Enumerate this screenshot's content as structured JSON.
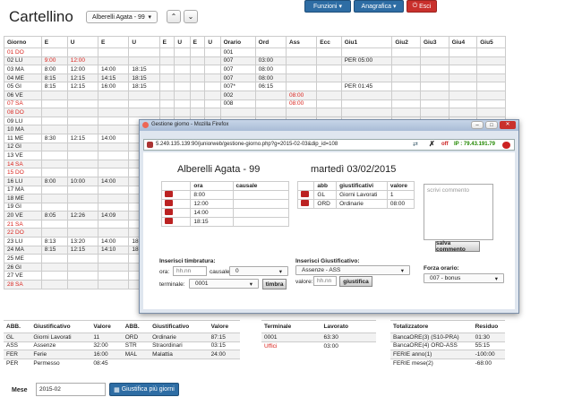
{
  "title": "Cartellino",
  "employee_select": "Alberelli Agata - 99",
  "nav": {
    "funzioni": "Funzioni",
    "anagrafica": "Anagrafica",
    "esci": "Esci"
  },
  "grid": {
    "headers": [
      "Giorno",
      "E",
      "U",
      "E",
      "U",
      "E",
      "U",
      "E",
      "U",
      "Orario",
      "Ord",
      "Ass",
      "Ecc",
      "Giu1",
      "Giu2",
      "Giu3",
      "Giu4",
      "Giu5"
    ],
    "rows": [
      [
        "01 DO",
        "",
        "",
        "",
        "",
        "",
        "",
        "",
        "",
        "001",
        "",
        "",
        "",
        "",
        "",
        "",
        "",
        ""
      ],
      [
        "02 LU",
        "9:00",
        "12:00",
        "",
        "",
        "",
        "",
        "",
        "",
        "007",
        "03:00",
        "",
        "",
        "PER 05:00",
        "",
        "",
        "",
        ""
      ],
      [
        "03 MA",
        "8:00",
        "12:00",
        "14:00",
        "18:15",
        "",
        "",
        "",
        "",
        "007",
        "08:00",
        "",
        "",
        "",
        "",
        "",
        "",
        ""
      ],
      [
        "04 ME",
        "8:15",
        "12:15",
        "14:15",
        "18:15",
        "",
        "",
        "",
        "",
        "007",
        "08:00",
        "",
        "",
        "",
        "",
        "",
        "",
        ""
      ],
      [
        "05 GI",
        "8:15",
        "12:15",
        "16:00",
        "18:15",
        "",
        "",
        "",
        "",
        "007*",
        "06:15",
        "",
        "",
        "PER 01:45",
        "",
        "",
        "",
        ""
      ],
      [
        "06 VE",
        "",
        "",
        "",
        "",
        "",
        "",
        "",
        "",
        "002",
        "",
        "08:00",
        "",
        "",
        "",
        "",
        "",
        ""
      ],
      [
        "07 SA",
        "",
        "",
        "",
        "",
        "",
        "",
        "",
        "",
        "008",
        "",
        "08:00",
        "",
        "",
        "",
        "",
        "",
        ""
      ],
      [
        "08 DO",
        "",
        "",
        "",
        "",
        "",
        "",
        "",
        "",
        "",
        "",
        "",
        "",
        "",
        "",
        "",
        "",
        ""
      ],
      [
        "09 LU",
        "",
        "",
        "",
        "",
        "",
        "",
        "",
        "",
        "",
        "",
        "",
        "",
        "",
        "",
        "",
        "",
        ""
      ],
      [
        "10 MA",
        "",
        "",
        "",
        "",
        "",
        "",
        "",
        "",
        "",
        "",
        "",
        "",
        "",
        "",
        "",
        "",
        ""
      ],
      [
        "11 ME",
        "8:30",
        "12:15",
        "14:00",
        "",
        "",
        "",
        "",
        "",
        "",
        "",
        "",
        "",
        "",
        "",
        "",
        "",
        ""
      ],
      [
        "12 GI",
        "",
        "",
        "",
        "",
        "",
        "",
        "",
        "",
        "",
        "",
        "",
        "",
        "",
        "",
        "",
        "",
        ""
      ],
      [
        "13 VE",
        "",
        "",
        "",
        "",
        "",
        "",
        "",
        "",
        "",
        "",
        "",
        "",
        "",
        "",
        "",
        "",
        ""
      ],
      [
        "14 SA",
        "",
        "",
        "",
        "",
        "",
        "",
        "",
        "",
        "",
        "",
        "",
        "",
        "",
        "",
        "",
        "",
        ""
      ],
      [
        "15 DO",
        "",
        "",
        "",
        "",
        "",
        "",
        "",
        "",
        "",
        "",
        "",
        "",
        "",
        "",
        "",
        "",
        ""
      ],
      [
        "16 LU",
        "8:00",
        "10:00",
        "14:00",
        "",
        "",
        "",
        "",
        "",
        "",
        "",
        "",
        "",
        "",
        "",
        "",
        "",
        ""
      ],
      [
        "17 MA",
        "",
        "",
        "",
        "",
        "",
        "",
        "",
        "",
        "",
        "",
        "",
        "",
        "",
        "",
        "",
        "",
        ""
      ],
      [
        "18 ME",
        "",
        "",
        "",
        "",
        "",
        "",
        "",
        "",
        "",
        "",
        "",
        "",
        "",
        "",
        "",
        "",
        ""
      ],
      [
        "19 GI",
        "",
        "",
        "",
        "",
        "",
        "",
        "",
        "",
        "",
        "",
        "",
        "",
        "",
        "",
        "",
        "",
        ""
      ],
      [
        "20 VE",
        "8:05",
        "12:26",
        "14:09",
        "",
        "",
        "",
        "",
        "",
        "",
        "",
        "",
        "",
        "",
        "",
        "",
        "",
        ""
      ],
      [
        "21 SA",
        "",
        "",
        "",
        "",
        "",
        "",
        "",
        "",
        "",
        "",
        "",
        "",
        "",
        "",
        "",
        "",
        ""
      ],
      [
        "22 DO",
        "",
        "",
        "",
        "",
        "",
        "",
        "",
        "",
        "",
        "",
        "",
        "",
        "",
        "",
        "",
        "",
        ""
      ],
      [
        "23 LU",
        "8:13",
        "13:20",
        "14:00",
        "18",
        "",
        "",
        "",
        "",
        "",
        "",
        "",
        "",
        "",
        "",
        "",
        "",
        ""
      ],
      [
        "24 MA",
        "8:15",
        "12:15",
        "14:10",
        "18",
        "",
        "",
        "",
        "",
        "",
        "",
        "",
        "",
        "",
        "",
        "",
        "",
        ""
      ],
      [
        "25 ME",
        "",
        "",
        "",
        "",
        "",
        "",
        "",
        "",
        "",
        "",
        "",
        "",
        "",
        "",
        "",
        "",
        ""
      ],
      [
        "26 GI",
        "",
        "",
        "",
        "",
        "",
        "",
        "",
        "",
        "",
        "",
        "",
        "",
        "",
        "",
        "",
        "",
        ""
      ],
      [
        "27 VE",
        "",
        "",
        "",
        "",
        "",
        "",
        "",
        "",
        "",
        "",
        "",
        "",
        "",
        "",
        "",
        "",
        ""
      ],
      [
        "28 SA",
        "",
        "",
        "",
        "",
        "",
        "",
        "",
        "",
        "",
        "",
        "",
        "",
        "",
        "",
        "",
        "",
        ""
      ]
    ],
    "red_days": [
      "01 DO",
      "07 SA",
      "08 DO",
      "14 SA",
      "15 DO",
      "21 SA",
      "22 DO",
      "28 SA"
    ],
    "red_cells": [
      "9:00",
      "12:00",
      "08:00"
    ]
  },
  "summary": {
    "headers": [
      "ABB.",
      "Giustificativo",
      "Valore",
      "ABB.",
      "Giustificativo",
      "Valore"
    ],
    "rows": [
      [
        "GL",
        "Giorni Lavorati",
        "11",
        "ORD",
        "Ordinarie",
        "87:15"
      ],
      [
        "ASS",
        "Assenze",
        "32:00",
        "STR",
        "Straordinari",
        "03:15"
      ],
      [
        "FER",
        "Ferie",
        "16:00",
        "MAL",
        "Malattia",
        "24:00"
      ],
      [
        "PER",
        "Permesso",
        "08:45",
        "",
        "",
        ""
      ]
    ]
  },
  "terminali": {
    "headers": [
      "Terminale",
      "Lavorato"
    ],
    "rows": [
      [
        "0001",
        "63:30"
      ],
      [
        "Uffici",
        "03:00"
      ]
    ]
  },
  "totalizzatori": {
    "headers": [
      "Totalizzatore",
      "Residuo"
    ],
    "rows": [
      [
        "BancaORE(3) (S10-PRA)",
        "01:30"
      ],
      [
        "BancaORE(4) ORD-ASS",
        "55:15"
      ],
      [
        "FERIE anno(1)",
        "-100:00"
      ],
      [
        "FERIE mese(2)",
        "-68:00"
      ]
    ]
  },
  "mese": {
    "label": "Mese",
    "value": "2015-02",
    "button": "Giustifica più giorni"
  },
  "popup": {
    "window_title": "Gestione giorno - Mozilla Firefox",
    "url": "5.249.135.139:90/juniorweb/gestione-giorno.php?g=2015-02-03&dip_id=108",
    "status": "off",
    "ip": "IP : 79.43.191.79",
    "name": "Alberelli Agata - 99",
    "date": "martedì 03/02/2015",
    "timbrature": {
      "headers": [
        "",
        "ora",
        "causale"
      ],
      "rows": [
        [
          "",
          "8:00",
          ""
        ],
        [
          "",
          "12:00",
          ""
        ],
        [
          "",
          "14:00",
          ""
        ],
        [
          "",
          "18:15",
          ""
        ]
      ]
    },
    "giustificativi": {
      "headers": [
        "",
        "abb",
        "giustificativi",
        "valore"
      ],
      "rows": [
        [
          "",
          "GL",
          "Giorni Lavorati",
          "1"
        ],
        [
          "",
          "ORD",
          "Ordinarie",
          "08:00"
        ]
      ]
    },
    "commento_placeholder": "scrivi commento",
    "salva": "salva commento",
    "ins_timbratura": "Inserisci timbratura:",
    "ora_label": "ora:",
    "ora_placeholder": "hh.nn",
    "causale_label": "causale:",
    "causale_value": "0",
    "terminale_label": "terminale:",
    "terminale_value": "0001",
    "timbra": "timbra",
    "ins_giust": "Inserisci Giustificativo:",
    "giust_value": "Assenze - ASS",
    "valore_label": "valore:",
    "valore_placeholder": "hh.nn",
    "giustifica": "giustifica",
    "forza_label": "Forza orario:",
    "forza_value": "007 - bonus"
  }
}
